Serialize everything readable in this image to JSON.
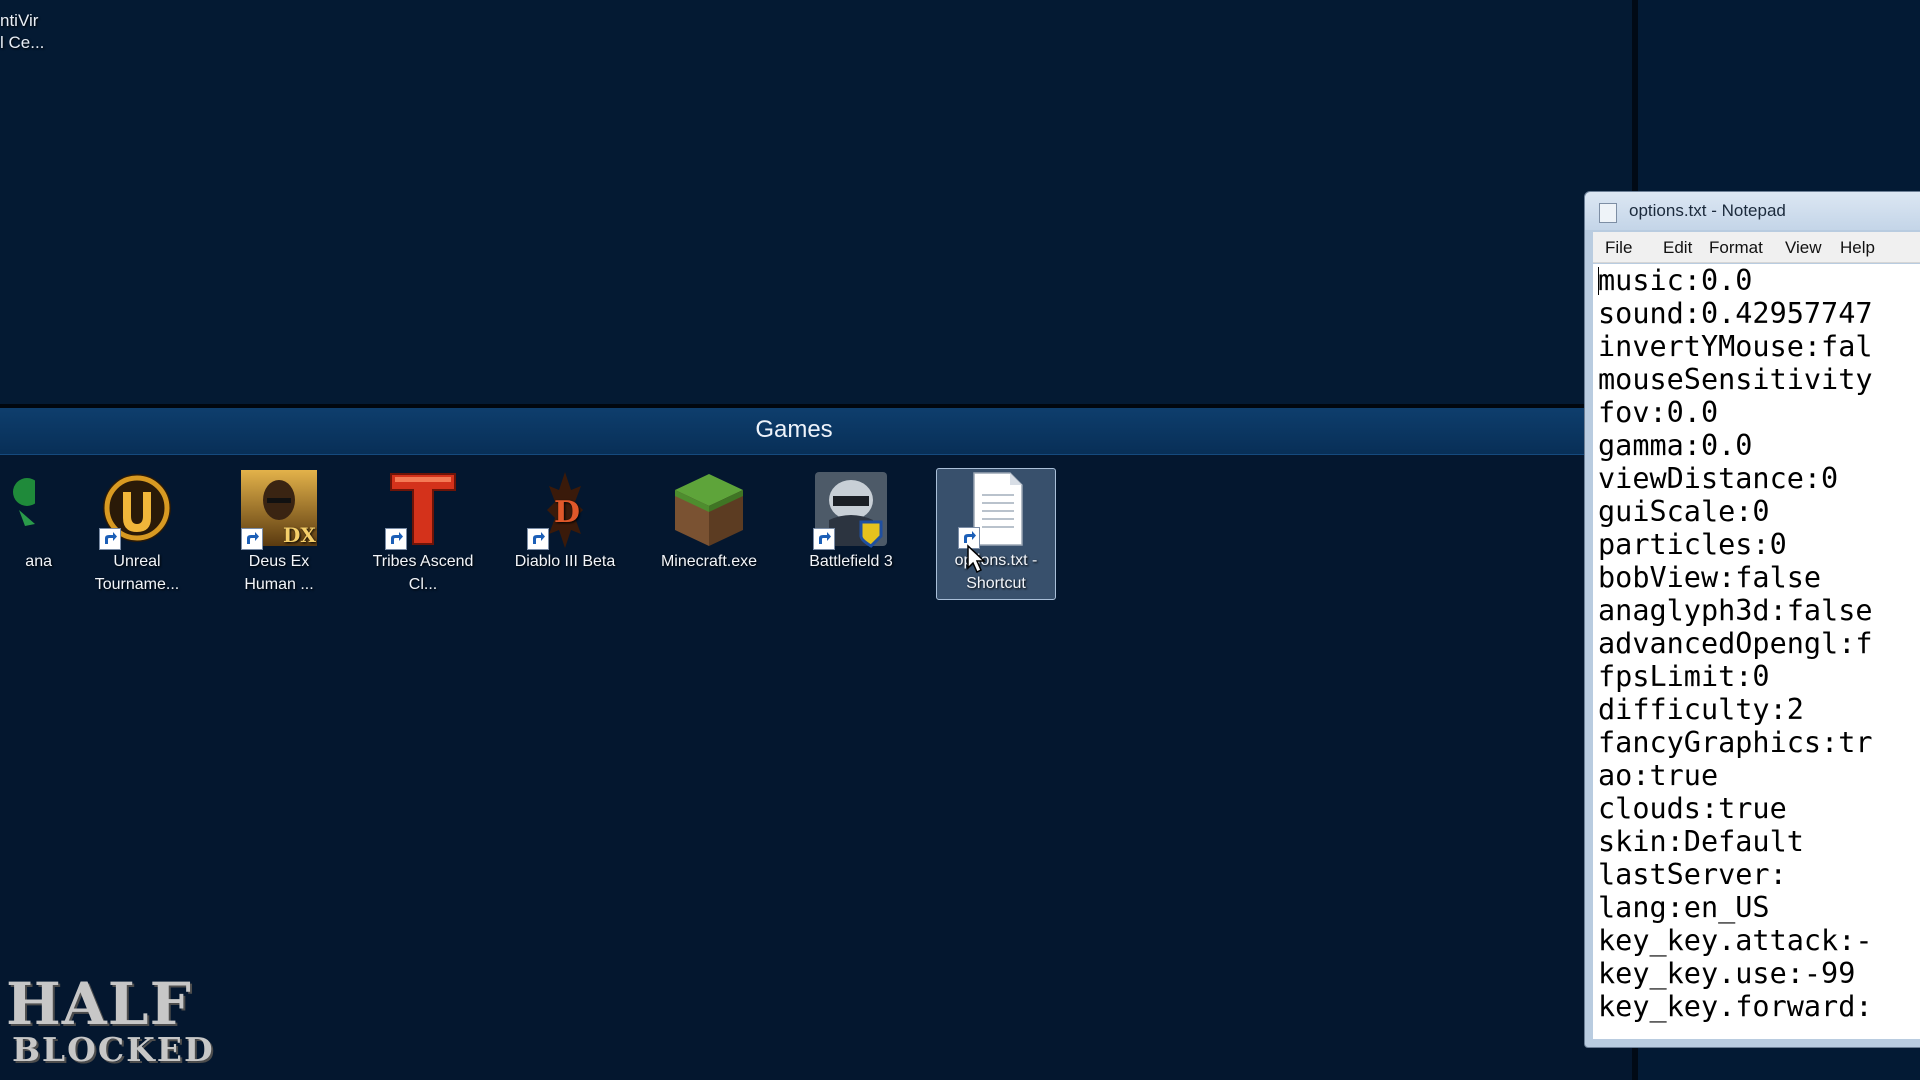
{
  "desktop": {
    "corner_icon": {
      "line1": "ntiVir",
      "line2": "l Ce..."
    }
  },
  "fence": {
    "title": "Games",
    "icons": [
      {
        "label": "ana",
        "icon": "app-icon-partial"
      },
      {
        "label": "Unreal Tourname...",
        "icon": "unreal-tournament-icon"
      },
      {
        "label": "Deus Ex Human ...",
        "icon": "deus-ex-icon"
      },
      {
        "label": "Tribes Ascend Cl...",
        "icon": "tribes-icon"
      },
      {
        "label": "Diablo III Beta",
        "icon": "diablo-icon"
      },
      {
        "label": "Minecraft.exe",
        "icon": "minecraft-icon"
      },
      {
        "label": "Battlefield 3",
        "icon": "battlefield-icon"
      },
      {
        "label": "options.txt - Shortcut",
        "icon": "text-file-icon",
        "selected": true
      }
    ]
  },
  "notepad": {
    "title": "options.txt - Notepad",
    "menu": [
      "File",
      "Edit",
      "Format",
      "View",
      "Help"
    ],
    "lines": [
      "music:0.0",
      "sound:0.42957747",
      "invertYMouse:fal",
      "mouseSensitivity",
      "fov:0.0",
      "gamma:0.0",
      "viewDistance:0",
      "guiScale:0",
      "particles:0",
      "bobView:false",
      "anaglyph3d:false",
      "advancedOpengl:f",
      "fpsLimit:0",
      "difficulty:2",
      "fancyGraphics:tr",
      "ao:true",
      "clouds:true",
      "skin:Default",
      "lastServer:",
      "lang:en_US",
      "key_key.attack:-",
      "key_key.use:-99",
      "key_key.forward:"
    ]
  },
  "watermark": {
    "line1": "HALF",
    "line2": "BLOCKED"
  }
}
